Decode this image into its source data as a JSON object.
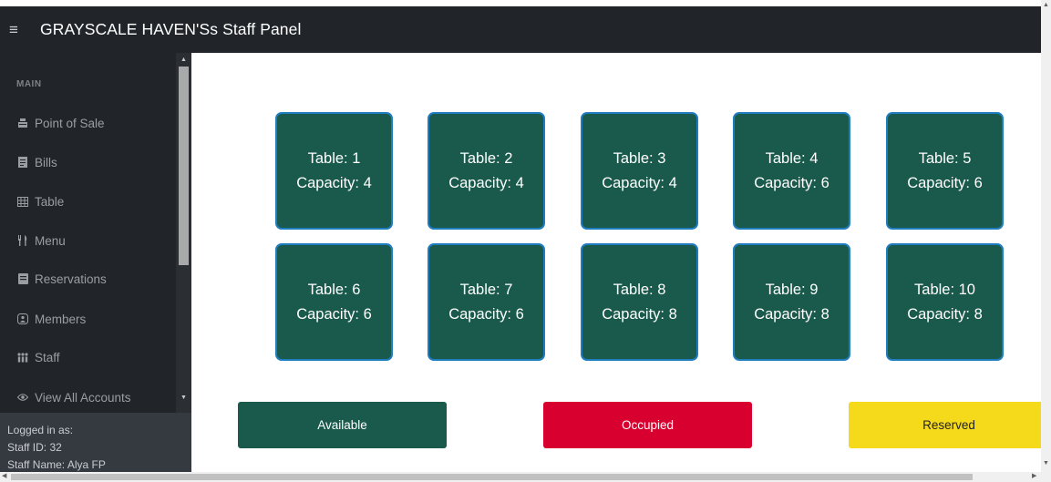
{
  "header": {
    "menu_icon": "hamburger-icon",
    "title": "GRAYSCALE HAVEN'Ss Staff Panel"
  },
  "sidebar": {
    "heading": "MAIN",
    "items": [
      {
        "label": "Point of Sale",
        "icon": "cash-register-icon"
      },
      {
        "label": "Bills",
        "icon": "receipt-icon"
      },
      {
        "label": "Table",
        "icon": "table-grid-icon"
      },
      {
        "label": "Menu",
        "icon": "utensils-icon"
      },
      {
        "label": "Reservations",
        "icon": "book-icon"
      },
      {
        "label": "Members",
        "icon": "members-icon"
      },
      {
        "label": "Staff",
        "icon": "staff-group-icon"
      },
      {
        "label": "View All Accounts",
        "icon": "eye-icon"
      }
    ],
    "footer": {
      "logged_in_label": "Logged in as:",
      "staff_id": "Staff ID: 32",
      "staff_name": "Staff Name: Alya FP"
    }
  },
  "tables": [
    {
      "label": "Table: 1",
      "capacity": "Capacity: 4"
    },
    {
      "label": "Table: 2",
      "capacity": "Capacity: 4"
    },
    {
      "label": "Table: 3",
      "capacity": "Capacity: 4"
    },
    {
      "label": "Table: 4",
      "capacity": "Capacity: 6"
    },
    {
      "label": "Table: 5",
      "capacity": "Capacity: 6"
    },
    {
      "label": "Table: 6",
      "capacity": "Capacity: 6"
    },
    {
      "label": "Table: 7",
      "capacity": "Capacity: 6"
    },
    {
      "label": "Table: 8",
      "capacity": "Capacity: 8"
    },
    {
      "label": "Table: 9",
      "capacity": "Capacity: 8"
    },
    {
      "label": "Table: 10",
      "capacity": "Capacity: 8"
    }
  ],
  "legend": {
    "available": "Available",
    "occupied": "Occupied",
    "reserved": "Reserved"
  },
  "colors": {
    "available": "#1a5a4c",
    "occupied": "#d7002e",
    "reserved": "#f5da1b",
    "sidebar": "#212529"
  }
}
